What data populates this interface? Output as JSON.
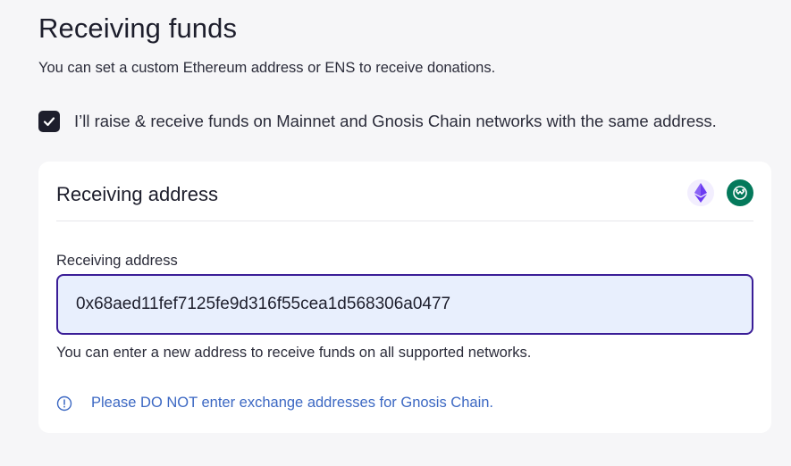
{
  "section": {
    "title": "Receiving funds",
    "subtitle": "You can set a custom Ethereum address or ENS to receive donations."
  },
  "same_address_option": {
    "checked": true,
    "label": "I’ll raise & receive funds on Mainnet and Gnosis Chain networks with the same address."
  },
  "card": {
    "title": "Receiving address",
    "network_icons": [
      "ethereum-icon",
      "gnosis-chain-icon"
    ],
    "field_label": "Receiving address",
    "field_value": "0x68aed11fef7125fe9d316f55cea1d568306a0477",
    "helper_text": "You can enter a new address to receive funds on all supported networks.",
    "warning_text": "Please DO NOT enter exchange addresses for Gnosis Chain."
  },
  "colors": {
    "input_border": "#3a1d97",
    "input_bg": "#e8effd",
    "warning": "#3c68c3",
    "ethereum": "#6c3bf2",
    "gnosis": "#04795b"
  }
}
